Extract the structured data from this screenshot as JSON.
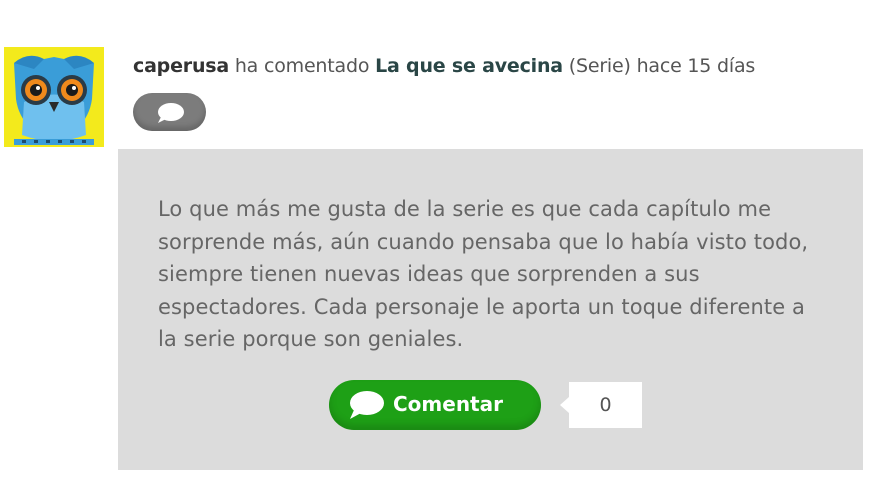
{
  "activity": {
    "user": "caperusa",
    "action": "ha comentado",
    "title": "La que se avecina",
    "type": "(Serie)",
    "time": "hace 15 días"
  },
  "icons": {
    "avatar": "owl-avatar",
    "comment": "speech-bubble-icon"
  },
  "comment": {
    "text": "Lo que más me gusta de la serie es que cada capítulo me sorprende más, aún cuando pensaba que lo había visto todo, siempre tienen nuevas ideas que sorprenden a sus espectadores. Cada personaje le aporta un toque diferente a la serie porque son geniales."
  },
  "actions": {
    "comment_label": "Comentar",
    "comment_count": "0"
  },
  "colors": {
    "avatar_bg": "#f3ea1c",
    "bubble_bg": "#dcdcdc",
    "comment_button": "#1ea016",
    "icon_button": "#7c7c7c"
  }
}
